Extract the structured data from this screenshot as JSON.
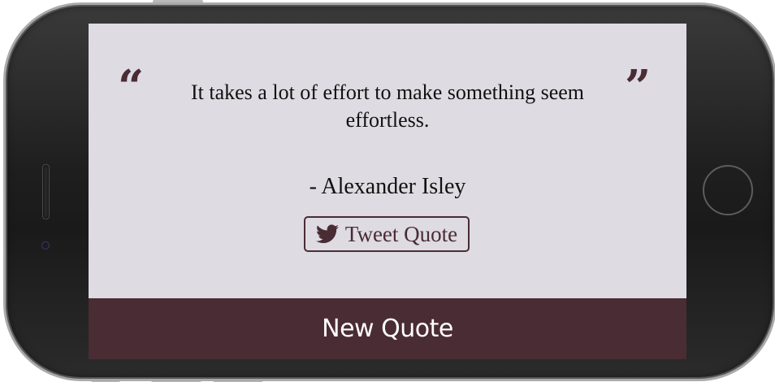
{
  "quote": {
    "open_mark": "“",
    "close_mark": "”",
    "text": "It takes a lot of effort to make something seem effortless.",
    "author": "- Alexander Isley"
  },
  "actions": {
    "tweet_label": "Tweet Quote",
    "tweet_icon": "twitter-bird-icon",
    "new_quote_label": "New Quote"
  },
  "colors": {
    "accent": "#4a2c34",
    "screen_background": "#dedbe2",
    "text": "#111111"
  }
}
